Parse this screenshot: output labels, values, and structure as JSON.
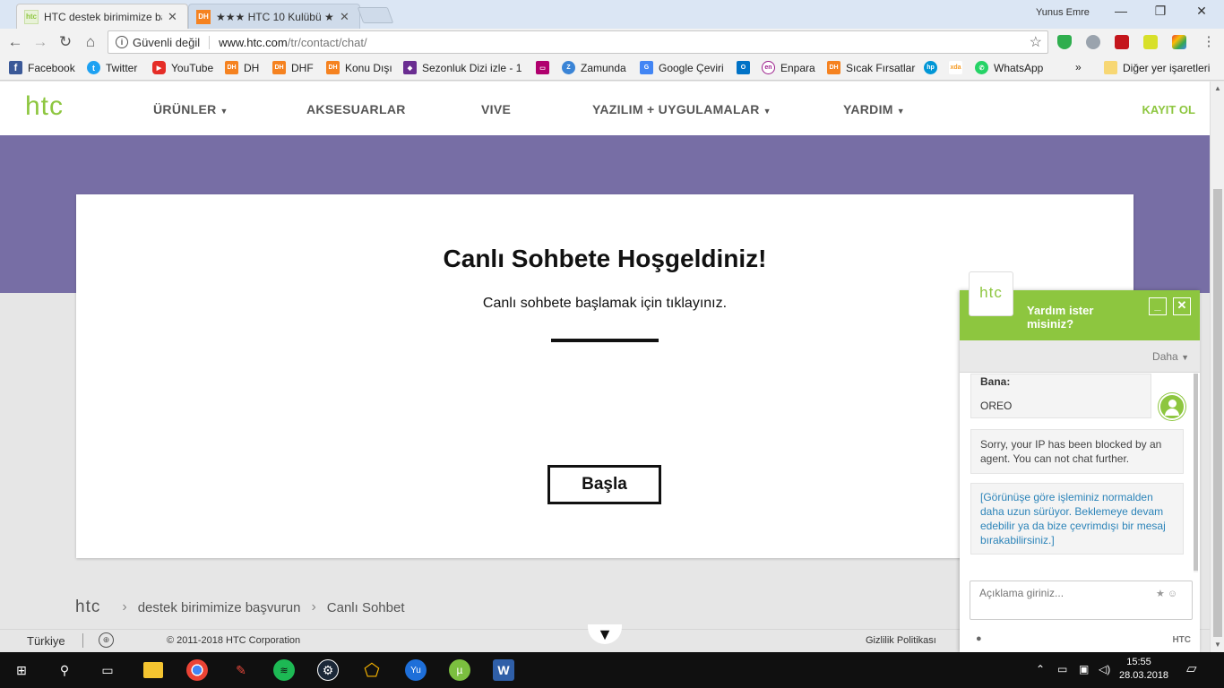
{
  "browser": {
    "tabs": [
      {
        "title": "HTC destek birimimize ba",
        "favicon": "htc"
      },
      {
        "title": "★★★ HTC 10 Kulübü ★★",
        "favicon": "DH"
      }
    ],
    "user": "Yunus Emre",
    "security": "Güvenli değil",
    "url_host": "www.htc.com",
    "url_path": "/tr/contact/chat/"
  },
  "bookmarks": [
    {
      "label": "Facebook",
      "icon": "facebook-icon",
      "color": "#3b5998",
      "glyph": "f"
    },
    {
      "label": "Twitter",
      "icon": "twitter-icon",
      "color": "#1da1f2",
      "glyph": "t"
    },
    {
      "label": "YouTube",
      "icon": "youtube-icon",
      "color": "#e52d27",
      "glyph": "▶"
    },
    {
      "label": "DH",
      "icon": "dh-icon",
      "color": "#f58220",
      "glyph": "DH"
    },
    {
      "label": "DHF",
      "icon": "dh-icon",
      "color": "#f58220",
      "glyph": "DH"
    },
    {
      "label": "Konu Dışı",
      "icon": "dh-icon",
      "color": "#f58220",
      "glyph": "DH"
    },
    {
      "label": "Sezonluk Dizi izle - 1(",
      "icon": "dizi-icon",
      "color": "#6a2d91",
      "glyph": "◆"
    },
    {
      "label": "",
      "icon": "tv-icon",
      "color": "#b0006e",
      "glyph": "▭"
    },
    {
      "label": "Zamunda",
      "icon": "zamunda-icon",
      "color": "#3a84d6",
      "glyph": "Z"
    },
    {
      "label": "Google Çeviri",
      "icon": "translate-icon",
      "color": "#4285f4",
      "glyph": "G"
    },
    {
      "label": "",
      "icon": "outlook-icon",
      "color": "#0072c6",
      "glyph": "O"
    },
    {
      "label": "Enpara",
      "icon": "enpara-icon",
      "color": "#9b1d8b",
      "glyph": "en"
    },
    {
      "label": "Sıcak Fırsatlar",
      "icon": "dh-icon",
      "color": "#f58220",
      "glyph": "DH"
    },
    {
      "label": "",
      "icon": "hp-icon",
      "color": "#0096d6",
      "glyph": "hp"
    },
    {
      "label": "",
      "icon": "xda-icon",
      "color": "#f59a23",
      "glyph": "xda"
    },
    {
      "label": "WhatsApp",
      "icon": "whatsapp-icon",
      "color": "#25d366",
      "glyph": "✆"
    }
  ],
  "bookmarks_other": "Diğer yer işaretleri",
  "site": {
    "logo": "htc",
    "nav": [
      {
        "label": "ÜRÜNLER",
        "caret": true
      },
      {
        "label": "AKSESUARLAR",
        "caret": false
      },
      {
        "label": "VIVE",
        "caret": false
      },
      {
        "label": "YAZILIM + UYGULAMALAR",
        "caret": true
      },
      {
        "label": "YARDIM",
        "caret": true
      }
    ],
    "login": "KAYIT OL"
  },
  "card": {
    "title": "Canlı Sohbete Hoşgeldiniz!",
    "subtitle": "Canlı sohbete başlamak için tıklayınız.",
    "button": "Başla"
  },
  "breadcrumb": {
    "root": "htc",
    "items": [
      "destek birimimize başvurun",
      "Canlı Sohbet"
    ]
  },
  "footer": {
    "country": "Türkiye",
    "copyright": "© 2011-2018 HTC Corporation",
    "privacy": "Gizlilik Politikası"
  },
  "chat": {
    "logo": "htc",
    "title": "Yardım ister misiniz?",
    "more": "Daha",
    "user_label": "Bana:",
    "user_message": "OREO",
    "system_message": "Sorry, your IP has been blocked by an agent. You can not chat further.",
    "info_message": "[Görünüşe göre işleminiz normalden daha uzun sürüyor. Beklemeye devam edebilir ya da bize çevrimdışı bir mesaj bırakabilirsiniz.]",
    "input_placeholder": "Açıklama giriniz...",
    "brand": "HTC"
  },
  "taskbar": {
    "time": "15:55",
    "date": "28.03.2018"
  },
  "colors": {
    "htc_green": "#8dc63f",
    "hero_purple": "#776ea5",
    "info_blue": "#2c84b9"
  }
}
